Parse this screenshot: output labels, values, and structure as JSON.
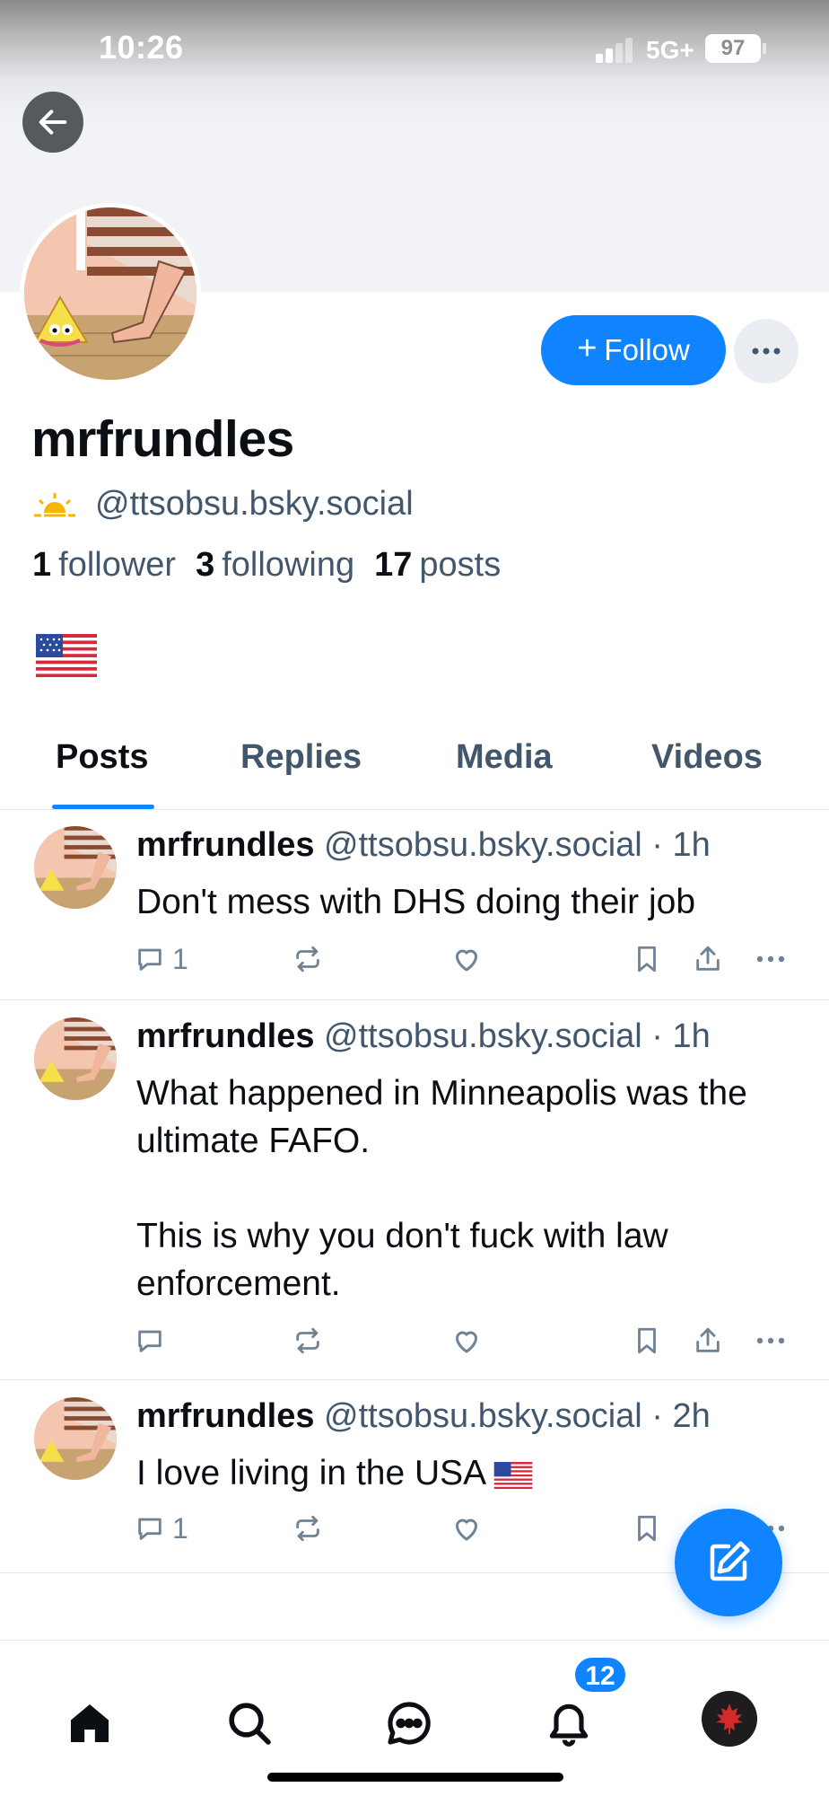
{
  "status_bar": {
    "time": "10:26",
    "network": "5G+",
    "battery": "97"
  },
  "profile": {
    "display_name": "mrfrundles",
    "handle": "@ttsobsu.bsky.social",
    "follow_label": "Follow",
    "followers_count": "1",
    "followers_label": "follower",
    "following_count": "3",
    "following_label": "following",
    "posts_count": "17",
    "posts_label": "posts",
    "bio_emoji": "us-flag"
  },
  "tabs": [
    {
      "label": "Posts",
      "active": true
    },
    {
      "label": "Replies",
      "active": false
    },
    {
      "label": "Media",
      "active": false
    },
    {
      "label": "Videos",
      "active": false
    }
  ],
  "posts": [
    {
      "author": "mrfrundles",
      "meta": "@ttsobsu.bsky.social · 1h",
      "text": "Don't mess with DHS doing their job",
      "reply_count": "1"
    },
    {
      "author": "mrfrundles",
      "meta": "@ttsobsu.bsky.social · 1h",
      "text": "What happened in Minneapolis was the ultimate FAFO.\n\nThis is why you don't fuck with law enforcement.",
      "reply_count": ""
    },
    {
      "author": "mrfrundles",
      "meta": "@ttsobsu.bsky.social · 2h",
      "text": "I love living in the USA",
      "reply_count": "1"
    }
  ],
  "nav": {
    "notifications_badge": "12"
  },
  "colors": {
    "accent": "#1083fe",
    "muted": "#42576c",
    "icon": "#6f8296"
  }
}
